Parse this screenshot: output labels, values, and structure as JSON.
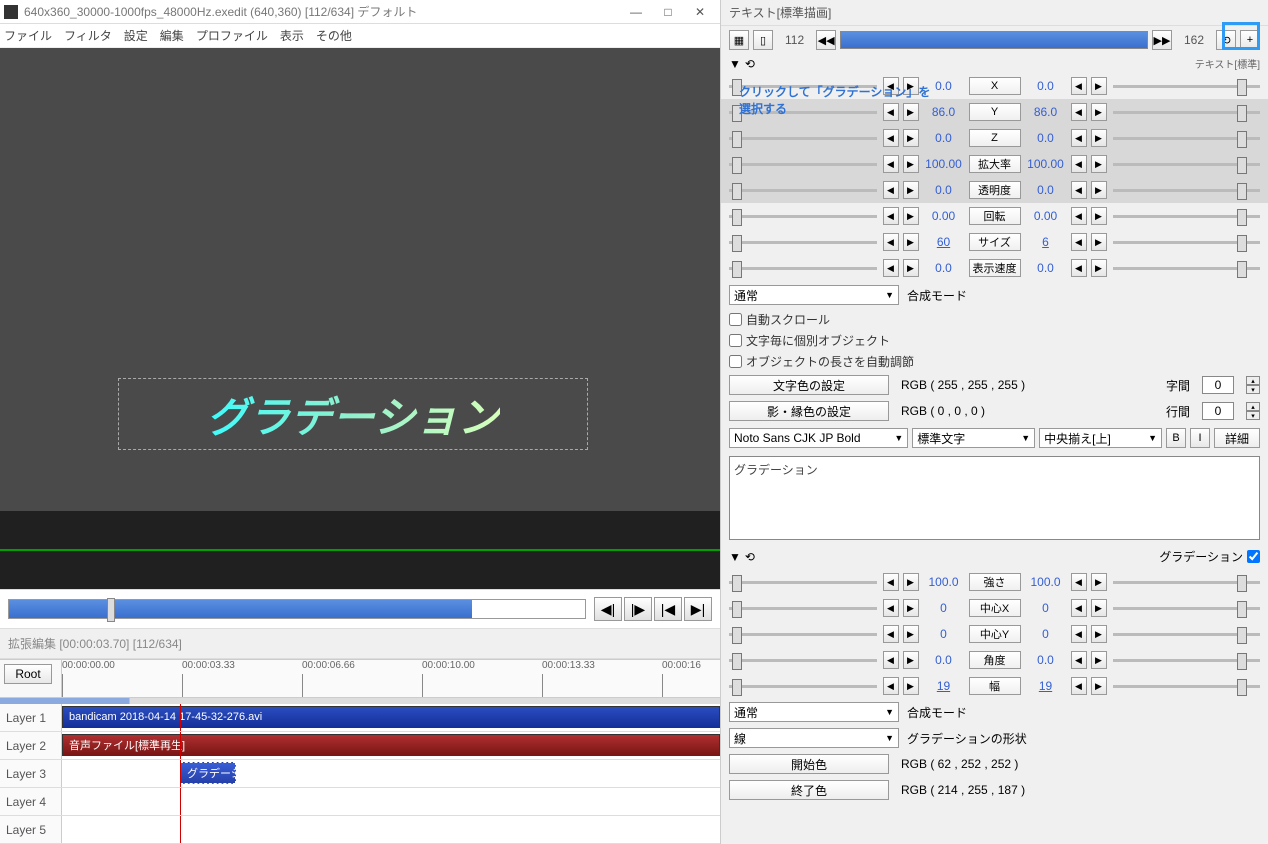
{
  "title": "640x360_30000-1000fps_48000Hz.exedit (640,360) [112/634] デフォルト",
  "menus": [
    "ファイル",
    "フィルタ",
    "設定",
    "編集",
    "プロファイル",
    "表示",
    "その他"
  ],
  "preview_text": "グラデーション",
  "timeline_title": "拡張編集 [00:00:03.70] [112/634]",
  "root_btn": "Root",
  "ticks": [
    "00:00:00.00",
    "00:00:03.33",
    "00:00:06.66",
    "00:00:10.00",
    "00:00:13.33",
    "00:00:16"
  ],
  "layers": [
    "Layer 1",
    "Layer 2",
    "Layer 3",
    "Layer 4",
    "Layer 5"
  ],
  "clip_video": "bandicam 2018-04-14 17-45-32-276.avi",
  "clip_audio": "音声ファイル[標準再生]",
  "clip_text": "グラデーシ",
  "rp_title": "テキスト[標準描画]",
  "frame_start": "112",
  "frame_end": "162",
  "rp_caption": "テキスト[標準]",
  "annotation_l1": "クリックして「グラデーション」を",
  "annotation_l2": "選択する",
  "props": [
    {
      "l": "0.0",
      "label": "X",
      "r": "0.0",
      "hl": false
    },
    {
      "l": "86.0",
      "label": "Y",
      "r": "86.0",
      "hl": true
    },
    {
      "l": "0.0",
      "label": "Z",
      "r": "0.0",
      "hl": true
    },
    {
      "l": "100.00",
      "label": "拡大率",
      "r": "100.00",
      "hl": true
    },
    {
      "l": "0.0",
      "label": "透明度",
      "r": "0.0",
      "hl": true
    },
    {
      "l": "0.00",
      "label": "回転",
      "r": "0.00",
      "hl": false
    },
    {
      "l": "60",
      "label": "サイズ",
      "r": "6",
      "hl": false,
      "under": true
    },
    {
      "l": "0.0",
      "label": "表示速度",
      "r": "0.0",
      "hl": false
    }
  ],
  "blend_mode_label": "合成モード",
  "blend_mode": "通常",
  "chk1": "自動スクロール",
  "chk2": "文字毎に個別オブジェクト",
  "chk3": "オブジェクトの長さを自動調節",
  "text_color_btn": "文字色の設定",
  "text_color_rgb": "RGB ( 255 , 255 , 255 )",
  "shadow_color_btn": "影・縁色の設定",
  "shadow_color_rgb": "RGB ( 0 , 0 , 0 )",
  "char_spacing_label": "字間",
  "char_spacing": "0",
  "line_spacing_label": "行間",
  "line_spacing": "0",
  "font": "Noto Sans CJK JP Bold",
  "decoration": "標準文字",
  "align": "中央揃え[上]",
  "b_btn": "B",
  "i_btn": "I",
  "detail_btn": "詳細",
  "text_content": "グラデーション",
  "section2_label": "グラデーション",
  "props2": [
    {
      "l": "100.0",
      "label": "強さ",
      "r": "100.0"
    },
    {
      "l": "0",
      "label": "中心X",
      "r": "0"
    },
    {
      "l": "0",
      "label": "中心Y",
      "r": "0"
    },
    {
      "l": "0.0",
      "label": "角度",
      "r": "0.0"
    },
    {
      "l": "19",
      "label": "幅",
      "r": "19",
      "under": true
    }
  ],
  "grad_blend": "通常",
  "grad_shape_label": "グラデーションの形状",
  "grad_shape": "線",
  "start_color_btn": "開始色",
  "start_color": "RGB ( 62 , 252 , 252 )",
  "end_color_btn": "終了色",
  "end_color": "RGB ( 214 , 255 , 187 )"
}
